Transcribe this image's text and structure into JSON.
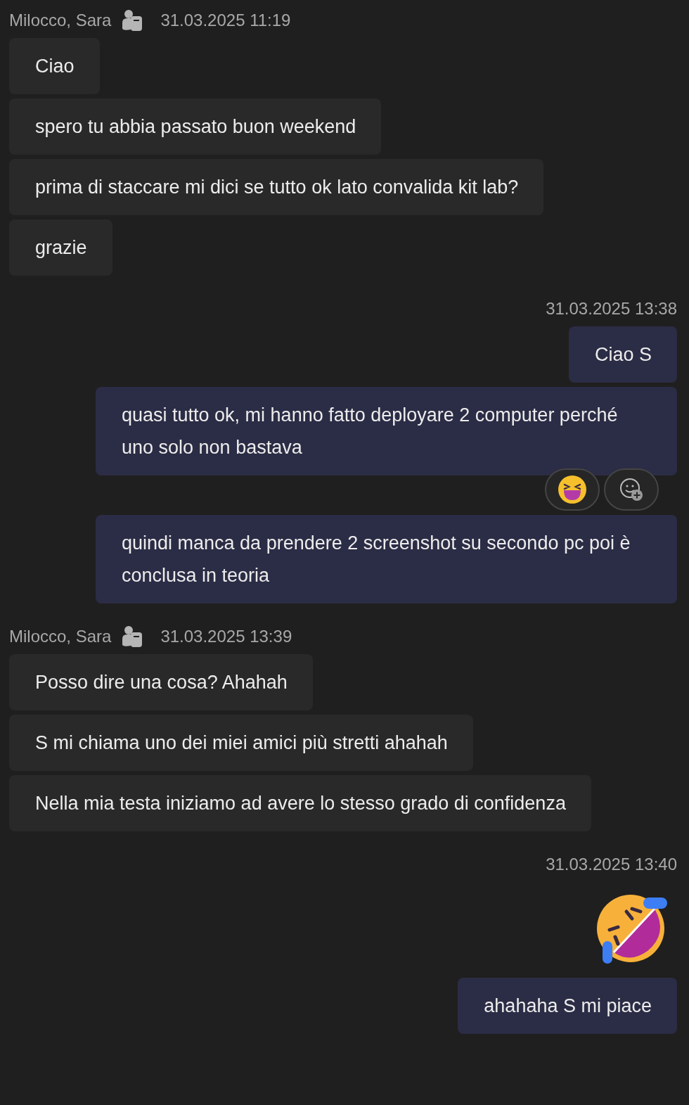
{
  "groups": [
    {
      "kind": "received",
      "sender": "Milocco, Sara",
      "time": "31.03.2025 11:19",
      "messages": [
        {
          "kind": "text",
          "text": "Ciao"
        },
        {
          "kind": "text",
          "text": "spero tu abbia passato buon weekend"
        },
        {
          "kind": "text",
          "text": "prima di staccare mi dici se tutto ok lato convalida kit lab?"
        },
        {
          "kind": "text",
          "text": "grazie"
        }
      ]
    },
    {
      "kind": "sent",
      "time": "31.03.2025 13:38",
      "messages": [
        {
          "kind": "text",
          "text": "Ciao S"
        },
        {
          "kind": "text",
          "text": "quasi tutto ok, mi hanno fatto deployare 2 computer perché uno solo non bastava",
          "reacted": true
        },
        {
          "kind": "text",
          "text": "quindi manca da prendere 2 screenshot su secondo pc poi è conclusa in teoria"
        }
      ]
    },
    {
      "kind": "received",
      "sender": "Milocco, Sara",
      "time": "31.03.2025 13:39",
      "messages": [
        {
          "kind": "text",
          "text": "Posso dire una cosa? Ahahah"
        },
        {
          "kind": "text",
          "text": "S mi chiama uno dei miei amici più stretti ahahah"
        },
        {
          "kind": "text",
          "text": "Nella mia testa iniziamo ad avere lo stesso grado di confidenza"
        }
      ]
    },
    {
      "kind": "sent",
      "time": "31.03.2025 13:40",
      "messages": [
        {
          "kind": "emoji"
        },
        {
          "kind": "text",
          "text": "ahahaha S mi piace"
        }
      ]
    }
  ]
}
